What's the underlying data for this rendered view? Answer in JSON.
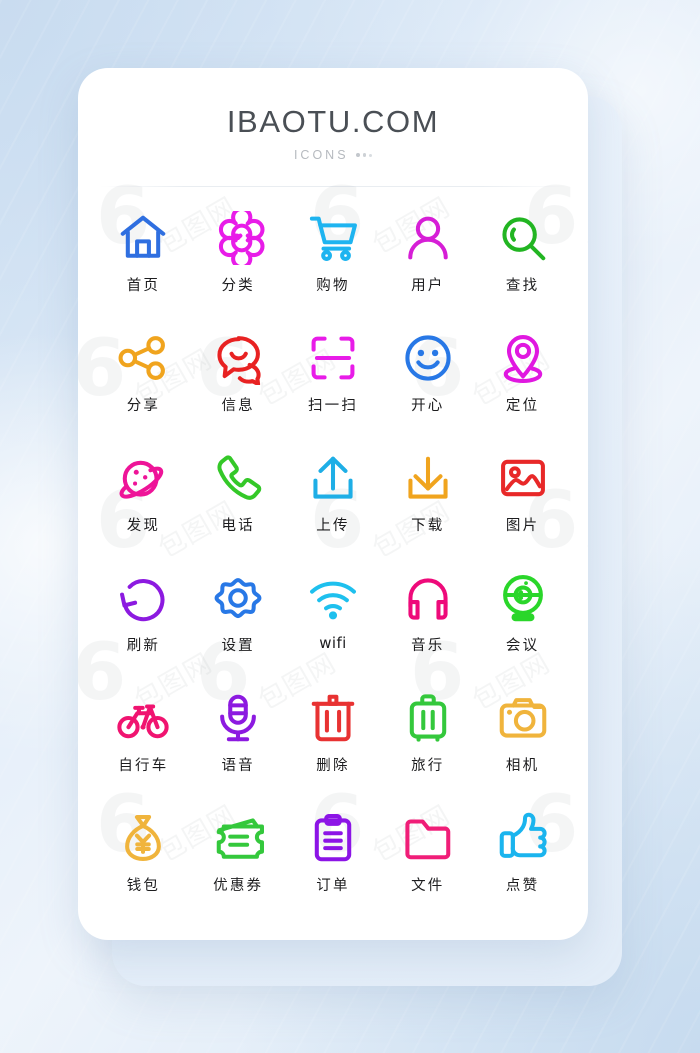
{
  "brand": {
    "title": "IBAOTU.COM",
    "subtitle": "ICONS"
  },
  "watermark": {
    "logo": "6",
    "text": "包图网"
  },
  "colors": {
    "background_top": "#d2e3f4",
    "background_bottom": "#d8e7f5",
    "card": "#ffffff",
    "label": "#1d1d1f",
    "brand_title": "#4a4f55",
    "brand_subtitle": "#b6babf"
  },
  "icons": [
    {
      "label": "首页",
      "name": "home-icon",
      "color": "#2f6fe0"
    },
    {
      "label": "分类",
      "name": "categories-icon",
      "color": "#e81ce8"
    },
    {
      "label": "购物",
      "name": "cart-icon",
      "color": "#1eb4f0"
    },
    {
      "label": "用户",
      "name": "user-icon",
      "color": "#d61ed6"
    },
    {
      "label": "查找",
      "name": "search-icon",
      "color": "#22b522"
    },
    {
      "label": "分享",
      "name": "share-icon",
      "color": "#f0a41e"
    },
    {
      "label": "信息",
      "name": "message-icon",
      "color": "#e82222"
    },
    {
      "label": "扫一扫",
      "name": "scan-icon",
      "color": "#e81ce8"
    },
    {
      "label": "开心",
      "name": "smile-icon",
      "color": "#2878e6"
    },
    {
      "label": "定位",
      "name": "location-icon",
      "color": "#e018e0"
    },
    {
      "label": "发现",
      "name": "planet-icon",
      "color": "#ee1498"
    },
    {
      "label": "电话",
      "name": "phone-icon",
      "color": "#34c828"
    },
    {
      "label": "上传",
      "name": "upload-icon",
      "color": "#1eaee6"
    },
    {
      "label": "下载",
      "name": "download-icon",
      "color": "#f0a41e"
    },
    {
      "label": "图片",
      "name": "image-icon",
      "color": "#e82828"
    },
    {
      "label": "刷新",
      "name": "refresh-icon",
      "color": "#8c1ae0"
    },
    {
      "label": "设置",
      "name": "settings-icon",
      "color": "#2878e6"
    },
    {
      "label": "wifi",
      "name": "wifi-icon",
      "color": "#1ec0ee"
    },
    {
      "label": "音乐",
      "name": "headphones-icon",
      "color": "#ee0a7a"
    },
    {
      "label": "会议",
      "name": "webcam-icon",
      "color": "#2ad62a"
    },
    {
      "label": "自行车",
      "name": "bicycle-icon",
      "color": "#f01470"
    },
    {
      "label": "语音",
      "name": "microphone-icon",
      "color": "#8c1ae0"
    },
    {
      "label": "删除",
      "name": "trash-icon",
      "color": "#e83232"
    },
    {
      "label": "旅行",
      "name": "suitcase-icon",
      "color": "#34c83c"
    },
    {
      "label": "相机",
      "name": "camera-icon",
      "color": "#f0b43c"
    },
    {
      "label": "钱包",
      "name": "wallet-icon",
      "color": "#f0b43c"
    },
    {
      "label": "优惠券",
      "name": "coupon-icon",
      "color": "#34c83c"
    },
    {
      "label": "订单",
      "name": "clipboard-icon",
      "color": "#8c14e6"
    },
    {
      "label": "文件",
      "name": "folder-icon",
      "color": "#f01e78"
    },
    {
      "label": "点赞",
      "name": "thumbs-up-icon",
      "color": "#1ab4ee"
    }
  ]
}
